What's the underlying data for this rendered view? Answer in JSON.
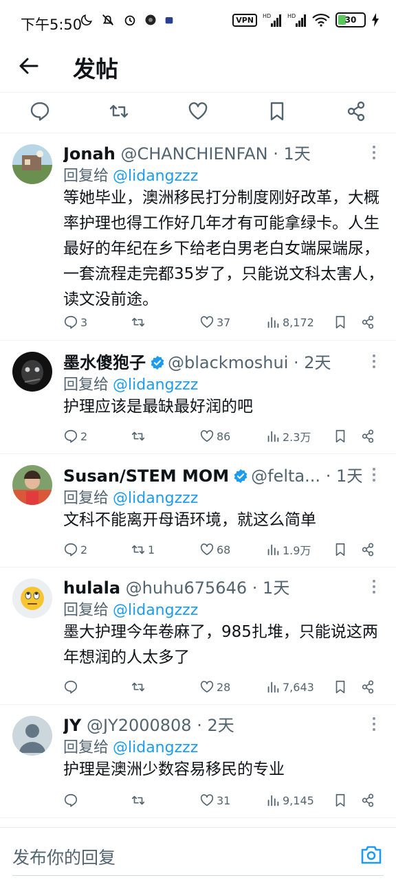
{
  "status_bar": {
    "time": "下午5:50",
    "vpn": "VPN",
    "battery": "30",
    "battery_level": 0.3,
    "network": "HD",
    "left_icons": [
      "moon-icon",
      "mute-icon",
      "alarm-icon",
      "app-icon",
      "app-icon"
    ],
    "right_icons": [
      "signal-icon",
      "signal-icon",
      "wifi-icon",
      "charging-icon"
    ]
  },
  "header": {
    "title": "发帖",
    "back_icon": "arrow-left-icon"
  },
  "action_bar": [
    "reply-icon",
    "retweet-icon",
    "like-icon",
    "bookmark-icon",
    "share-icon"
  ],
  "replies": [
    {
      "name": "Jonah",
      "verified": false,
      "handle": "@CHANCHIENFAN",
      "sep": "·",
      "time": "1天",
      "reply_label": "回复给",
      "reply_to": "@lidangzzz",
      "text": "等她毕业，澳洲移民打分制度刚好改革，大概率护理也得工作好几年才有可能拿绿卡。人生最好的年纪在乡下给老白男老白女端屎端尿，一套流程走完都35岁了，只能说文科太害人，读文没前途。",
      "stats": {
        "replies": "3",
        "retweets": "",
        "likes": "37",
        "views": "8,172"
      }
    },
    {
      "name": "墨水傻狍子",
      "verified": true,
      "handle": "@blackmoshui",
      "sep": "·",
      "time": "2天",
      "reply_label": "回复给",
      "reply_to": "@lidangzzz",
      "text": "护理应该是最缺最好润的吧",
      "stats": {
        "replies": "2",
        "retweets": "",
        "likes": "86",
        "views": "2.3万"
      }
    },
    {
      "name": "Susan/STEM MOM",
      "verified": true,
      "handle": "@felta...",
      "sep": "·",
      "time": "1天",
      "reply_label": "回复给",
      "reply_to": "@lidangzzz",
      "text": "文科不能离开母语环境，就这么简单",
      "stats": {
        "replies": "2",
        "retweets": "1",
        "likes": "68",
        "views": "1.9万"
      }
    },
    {
      "name": "hulala",
      "verified": false,
      "handle": "@huhu675646",
      "sep": "·",
      "time": "1天",
      "reply_label": "回复给",
      "reply_to": "@lidangzzz",
      "text": "墨大护理今年卷麻了，985扎堆，只能说这两年想润的人太多了",
      "stats": {
        "replies": "",
        "retweets": "",
        "likes": "28",
        "views": "7,643"
      }
    },
    {
      "name": "JY",
      "verified": false,
      "handle": "@JY2000808",
      "sep": "·",
      "time": "2天",
      "reply_label": "回复给",
      "reply_to": "@lidangzzz",
      "text": "护理是澳洲少数容易移民的专业",
      "stats": {
        "replies": "",
        "retweets": "",
        "likes": "31",
        "views": "9,145"
      }
    }
  ],
  "compose": {
    "placeholder": "发布你的回复",
    "camera_icon": "camera-icon"
  },
  "colors": {
    "accent": "#1d9bf0",
    "text": "#0f1419",
    "secondary": "#536471",
    "divider": "#eff3f4"
  }
}
